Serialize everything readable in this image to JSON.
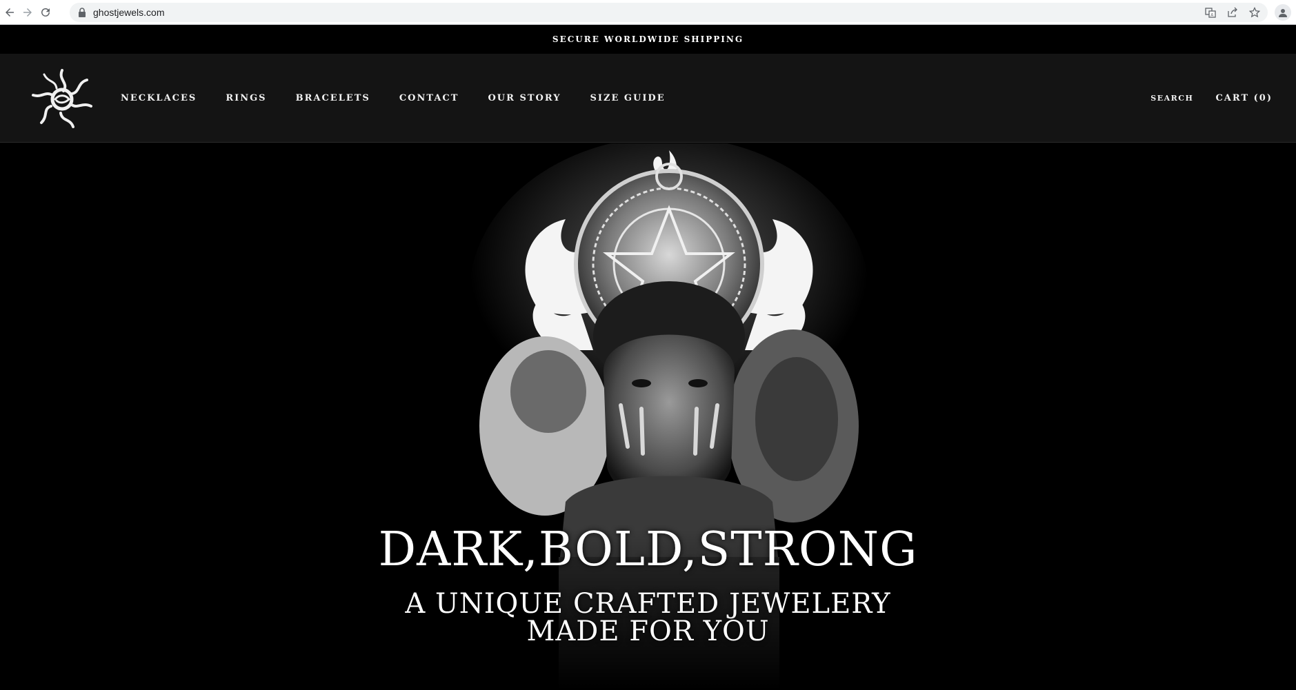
{
  "browser": {
    "url": "ghostjewels.com",
    "icons": [
      "back-arrow-icon",
      "forward-arrow-icon",
      "reload-icon",
      "lock-icon",
      "translate-icon",
      "share-icon",
      "star-icon",
      "profile-icon"
    ]
  },
  "announcement": {
    "text": "SECURE WORLDWIDE SHIPPING"
  },
  "header": {
    "nav": [
      {
        "label": "NECKLACES"
      },
      {
        "label": "RINGS"
      },
      {
        "label": "BRACELETS"
      },
      {
        "label": "CONTACT"
      },
      {
        "label": "OUR STORY"
      },
      {
        "label": "SIZE GUIDE"
      }
    ],
    "search_label": "SEARCH",
    "cart_label": "CART (0)"
  },
  "hero": {
    "title": "DARK,BOLD,STRONG",
    "subtitle_line1": "A UNIQUE CRAFTED JEWELERY",
    "subtitle_line2": "MADE FOR YOU"
  },
  "colors": {
    "page_bg": "#000000",
    "header_bg": "#141414",
    "text": "#ffffff",
    "browser_bar": "#ffffff",
    "url_box": "#f1f3f4"
  }
}
